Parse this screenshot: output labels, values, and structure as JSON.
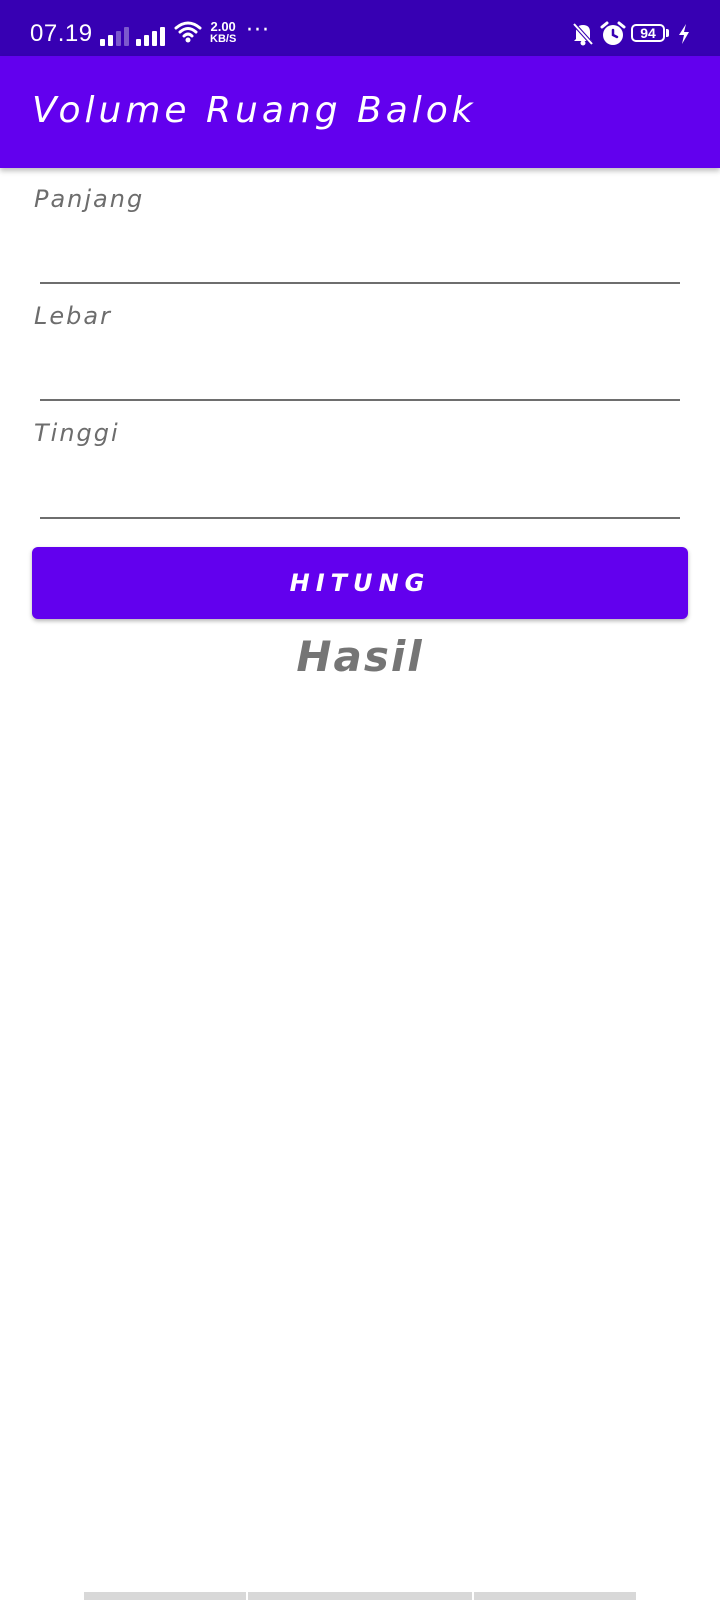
{
  "status_bar": {
    "time": "07.19",
    "net_speed_value": "2.00",
    "net_speed_unit": "KB/S",
    "more": "···",
    "battery": "94",
    "icons": [
      "signal-icon",
      "signal-icon",
      "wifi-icon",
      "bell-off-icon",
      "alarm-icon",
      "battery-icon",
      "charging-bolt-icon"
    ]
  },
  "app_bar": {
    "title": "Volume Ruang Balok"
  },
  "form": {
    "panjang_label": "Panjang",
    "panjang_value": "",
    "lebar_label": "Lebar",
    "lebar_value": "",
    "tinggi_label": "Tinggi",
    "tinggi_value": "",
    "button_label": "HITUNG"
  },
  "result": {
    "label": "Hasil"
  },
  "colors": {
    "status_bar": "#3700B3",
    "primary": "#6200EE",
    "label_gray": "#6D6D6D"
  }
}
